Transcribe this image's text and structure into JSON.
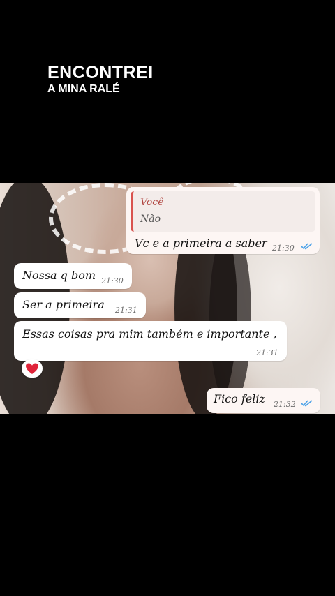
{
  "caption": {
    "line1": "ENCONTREI",
    "line2": "A MINA RALÉ"
  },
  "chat": {
    "messages": [
      {
        "direction": "outgoing",
        "quote": {
          "author": "Você",
          "text": "Não"
        },
        "text": "Vc e a primeira a saber",
        "time": "21:30",
        "status": "read"
      },
      {
        "direction": "incoming",
        "text": "Nossa q bom",
        "time": "21:30"
      },
      {
        "direction": "incoming",
        "text": "Ser a primeira",
        "time": "21:31"
      },
      {
        "direction": "incoming",
        "text": "Essas coisas pra mim também e importante ,",
        "time": "21:31"
      },
      {
        "direction": "outgoing",
        "text": "Fico feliz",
        "time": "21:32",
        "status": "read"
      }
    ],
    "reaction": {
      "icon": "red-heart-icon",
      "color": "#e0243a"
    }
  },
  "colors": {
    "read_ticks": "#4fa3e8",
    "quote_bar": "#d9534f",
    "quote_author": "#b0443f"
  }
}
